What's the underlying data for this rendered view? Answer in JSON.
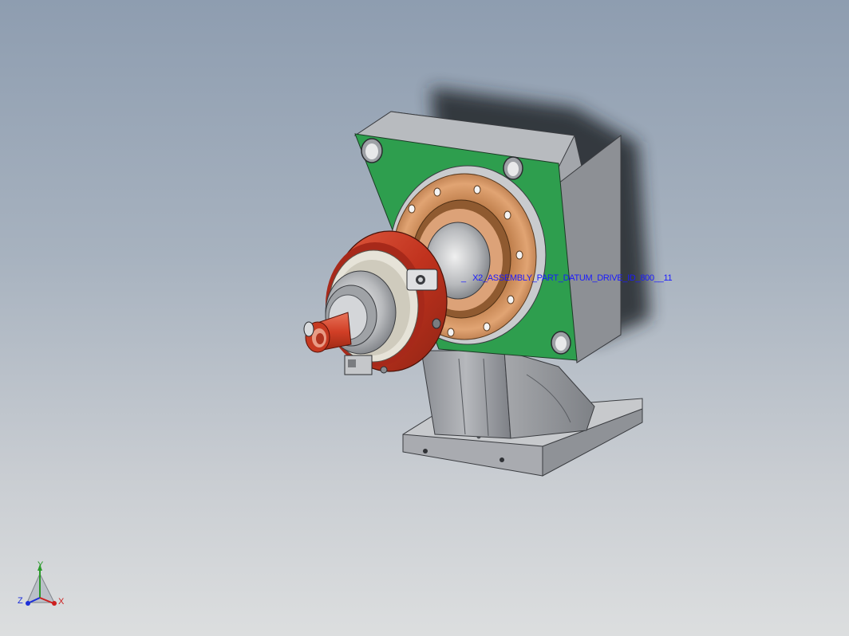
{
  "viewport": {
    "background_top": "#8e9db0",
    "background_bottom": "#dcdedf"
  },
  "model": {
    "annotation_text": "_   X2_ASSEMBLY_PART_DATUM_DRIVE_ID_800__11",
    "colors": {
      "housing": "#9c9ea4",
      "housing_dark": "#6f7278",
      "flange_plate": "#2e9e4e",
      "bearing_ring": "#d08e5a",
      "clamp_ring": "#c43a26",
      "shaft": "#d4462e",
      "annotation": "#1a1aff"
    }
  },
  "triad": {
    "y_label": "Y",
    "z_label": "Z",
    "x_label": "X",
    "y_color": "#2a9a2a",
    "z_color": "#1d2fd8",
    "x_color": "#cc1f1f"
  }
}
